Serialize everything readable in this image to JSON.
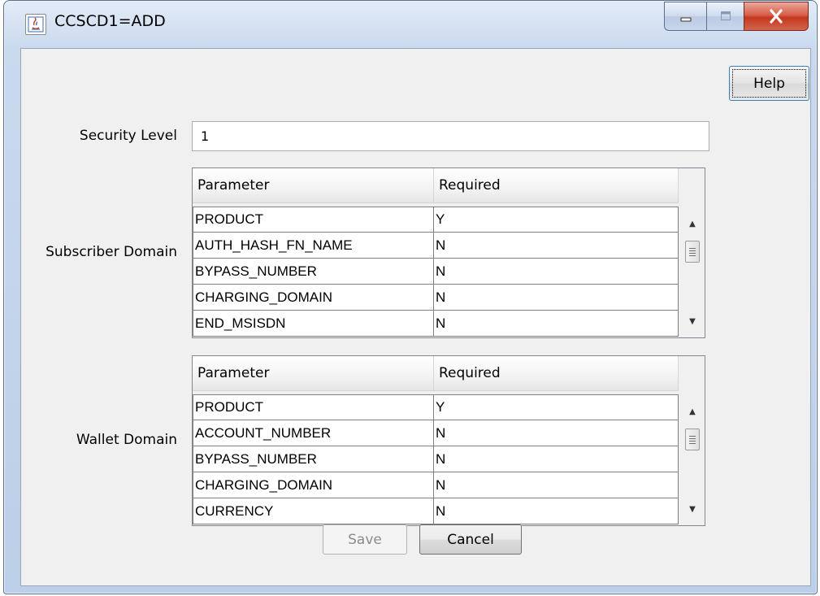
{
  "window": {
    "title": "CCSCD1=ADD",
    "controls": {
      "minimize": "minimize",
      "maximize": "maximize",
      "close": "close"
    }
  },
  "toolbar": {
    "help_label": "Help"
  },
  "security": {
    "label": "Security Level",
    "value": "1"
  },
  "subscriber_domain": {
    "label": "Subscriber Domain",
    "columns": [
      "Parameter",
      "Required"
    ],
    "rows": [
      [
        "PRODUCT",
        "Y"
      ],
      [
        "AUTH_HASH_FN_NAME",
        "N"
      ],
      [
        "BYPASS_NUMBER",
        "N"
      ],
      [
        "CHARGING_DOMAIN",
        "N"
      ],
      [
        "END_MSISDN",
        "N"
      ]
    ]
  },
  "wallet_domain": {
    "label": "Wallet Domain",
    "columns": [
      "Parameter",
      "Required"
    ],
    "rows": [
      [
        "PRODUCT",
        "Y"
      ],
      [
        "ACCOUNT_NUMBER",
        "N"
      ],
      [
        "BYPASS_NUMBER",
        "N"
      ],
      [
        "CHARGING_DOMAIN",
        "N"
      ],
      [
        "CURRENCY",
        "N"
      ]
    ]
  },
  "footer": {
    "save_label": "Save",
    "cancel_label": "Cancel",
    "save_enabled": false
  },
  "icons": {
    "app": "java-cup-icon",
    "minimize": "minimize-icon",
    "maximize": "maximize-icon",
    "close": "close-icon",
    "scroll_up": "chevron-up-icon",
    "scroll_down": "chevron-down-icon"
  },
  "colors": {
    "close_button": "#c3381f",
    "focus_border": "#3c7fb1",
    "disabled_text": "#8c8c8c"
  }
}
